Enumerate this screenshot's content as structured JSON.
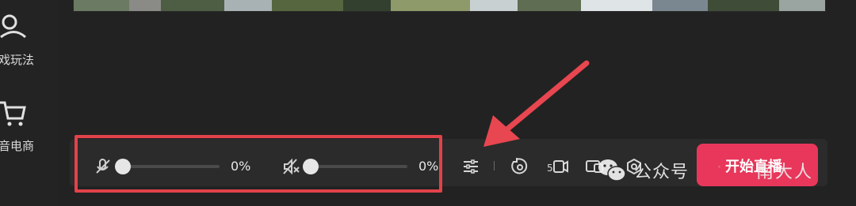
{
  "sidebar": {
    "items": [
      {
        "label": "戏玩法",
        "icon": "person-pin-icon"
      },
      {
        "label": "音电商",
        "icon": "shopping-cart-icon"
      }
    ]
  },
  "preview": {
    "content": "live-video-preview"
  },
  "audio": {
    "mic": {
      "icon": "mic-muted-icon",
      "percent": "0%",
      "level": 0
    },
    "speaker": {
      "icon": "speaker-muted-icon",
      "percent": "0%",
      "level": 0
    }
  },
  "tools": {
    "items": [
      {
        "icon": "sliders-icon"
      },
      {
        "icon": "rotate-camera-icon"
      },
      {
        "icon": "camera-timer-icon"
      },
      {
        "icon": "screen-share-icon"
      },
      {
        "icon": "settings-hex-icon"
      }
    ]
  },
  "start_button": {
    "label": "开始直播"
  },
  "watermark": {
    "text": "公众号",
    "dot": "·",
    "author": "南大人"
  },
  "colors": {
    "accent": "#e8375b",
    "highlight": "#e2424a",
    "arrow": "#e84650"
  }
}
